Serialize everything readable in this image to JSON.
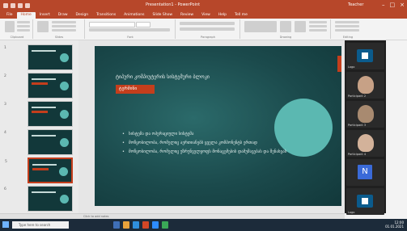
{
  "window": {
    "title": "Presentation1 - PowerPoint",
    "user": "Teacher"
  },
  "ribbon": {
    "tabs": [
      "File",
      "Home",
      "Insert",
      "Draw",
      "Design",
      "Transitions",
      "Animations",
      "Slide Show",
      "Review",
      "View",
      "Help",
      "Tell me"
    ],
    "active_tab": "Home",
    "groups": [
      "Clipboard",
      "Slides",
      "Font",
      "Paragraph",
      "Drawing",
      "Editing"
    ]
  },
  "thumbnails": [
    {
      "num": "1"
    },
    {
      "num": "2"
    },
    {
      "num": "3"
    },
    {
      "num": "4"
    },
    {
      "num": "5"
    },
    {
      "num": "6"
    },
    {
      "num": "7"
    }
  ],
  "slide": {
    "heading": "ტიპური კომპიუტერის სისტემური ბლოკი",
    "red_label": "ტერმინი",
    "bullets": [
      "სისტემა და ოპერაციული სისტემა",
      "მოწყობილობა, რომელიც აერთიანებს ყველა კომპონენტს ერთად",
      "მოწყობილობა, რომელიც უზრუნველყოფს მონაცემების დამუშავებას და შენახვას"
    ]
  },
  "notes": {
    "placeholder": "Click to add notes"
  },
  "video_call": {
    "participants": [
      {
        "name": "Logo",
        "type": "logo"
      },
      {
        "name": "Participant 2",
        "type": "person"
      },
      {
        "name": "Participant 3",
        "type": "person"
      },
      {
        "name": "Participant 4",
        "type": "person"
      },
      {
        "name": "N",
        "type": "initial"
      },
      {
        "name": "Logo",
        "type": "logo"
      }
    ]
  },
  "taskbar": {
    "search_placeholder": "Type here to search",
    "time": "12:00",
    "date": "01.01.2021"
  },
  "colors": {
    "accent": "#b7472a",
    "slide_bg": "#1b4a4c",
    "slide_red": "#c43e1c",
    "slide_teal": "#5bb8b1"
  }
}
